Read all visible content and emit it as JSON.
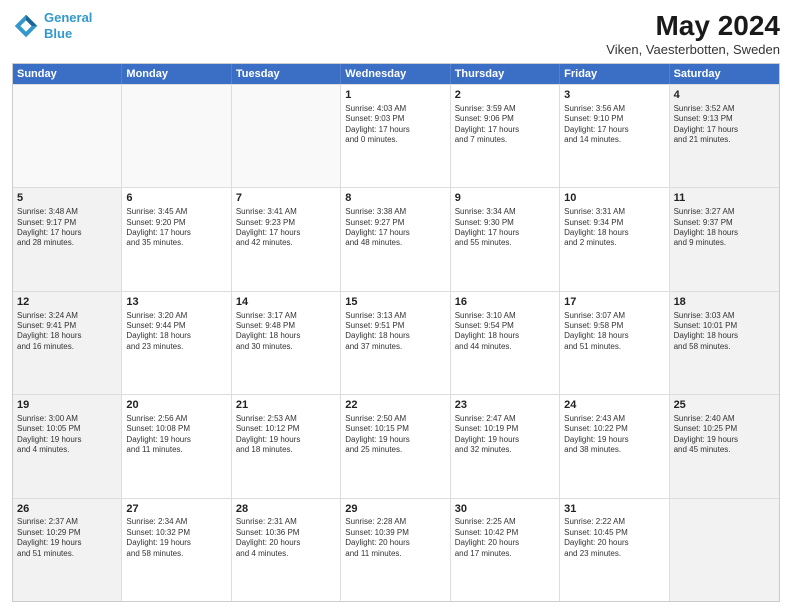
{
  "logo": {
    "line1": "General",
    "line2": "Blue"
  },
  "title": "May 2024",
  "subtitle": "Viken, Vaesterbotten, Sweden",
  "days": [
    "Sunday",
    "Monday",
    "Tuesday",
    "Wednesday",
    "Thursday",
    "Friday",
    "Saturday"
  ],
  "rows": [
    [
      {
        "day": "",
        "info": "",
        "empty": true
      },
      {
        "day": "",
        "info": "",
        "empty": true
      },
      {
        "day": "",
        "info": "",
        "empty": true
      },
      {
        "day": "1",
        "info": "Sunrise: 4:03 AM\nSunset: 9:03 PM\nDaylight: 17 hours\nand 0 minutes.",
        "empty": false
      },
      {
        "day": "2",
        "info": "Sunrise: 3:59 AM\nSunset: 9:06 PM\nDaylight: 17 hours\nand 7 minutes.",
        "empty": false
      },
      {
        "day": "3",
        "info": "Sunrise: 3:56 AM\nSunset: 9:10 PM\nDaylight: 17 hours\nand 14 minutes.",
        "empty": false
      },
      {
        "day": "4",
        "info": "Sunrise: 3:52 AM\nSunset: 9:13 PM\nDaylight: 17 hours\nand 21 minutes.",
        "empty": false,
        "shaded": true
      }
    ],
    [
      {
        "day": "5",
        "info": "Sunrise: 3:48 AM\nSunset: 9:17 PM\nDaylight: 17 hours\nand 28 minutes.",
        "empty": false,
        "shaded": true
      },
      {
        "day": "6",
        "info": "Sunrise: 3:45 AM\nSunset: 9:20 PM\nDaylight: 17 hours\nand 35 minutes.",
        "empty": false
      },
      {
        "day": "7",
        "info": "Sunrise: 3:41 AM\nSunset: 9:23 PM\nDaylight: 17 hours\nand 42 minutes.",
        "empty": false
      },
      {
        "day": "8",
        "info": "Sunrise: 3:38 AM\nSunset: 9:27 PM\nDaylight: 17 hours\nand 48 minutes.",
        "empty": false
      },
      {
        "day": "9",
        "info": "Sunrise: 3:34 AM\nSunset: 9:30 PM\nDaylight: 17 hours\nand 55 minutes.",
        "empty": false
      },
      {
        "day": "10",
        "info": "Sunrise: 3:31 AM\nSunset: 9:34 PM\nDaylight: 18 hours\nand 2 minutes.",
        "empty": false
      },
      {
        "day": "11",
        "info": "Sunrise: 3:27 AM\nSunset: 9:37 PM\nDaylight: 18 hours\nand 9 minutes.",
        "empty": false,
        "shaded": true
      }
    ],
    [
      {
        "day": "12",
        "info": "Sunrise: 3:24 AM\nSunset: 9:41 PM\nDaylight: 18 hours\nand 16 minutes.",
        "empty": false,
        "shaded": true
      },
      {
        "day": "13",
        "info": "Sunrise: 3:20 AM\nSunset: 9:44 PM\nDaylight: 18 hours\nand 23 minutes.",
        "empty": false
      },
      {
        "day": "14",
        "info": "Sunrise: 3:17 AM\nSunset: 9:48 PM\nDaylight: 18 hours\nand 30 minutes.",
        "empty": false
      },
      {
        "day": "15",
        "info": "Sunrise: 3:13 AM\nSunset: 9:51 PM\nDaylight: 18 hours\nand 37 minutes.",
        "empty": false
      },
      {
        "day": "16",
        "info": "Sunrise: 3:10 AM\nSunset: 9:54 PM\nDaylight: 18 hours\nand 44 minutes.",
        "empty": false
      },
      {
        "day": "17",
        "info": "Sunrise: 3:07 AM\nSunset: 9:58 PM\nDaylight: 18 hours\nand 51 minutes.",
        "empty": false
      },
      {
        "day": "18",
        "info": "Sunrise: 3:03 AM\nSunset: 10:01 PM\nDaylight: 18 hours\nand 58 minutes.",
        "empty": false,
        "shaded": true
      }
    ],
    [
      {
        "day": "19",
        "info": "Sunrise: 3:00 AM\nSunset: 10:05 PM\nDaylight: 19 hours\nand 4 minutes.",
        "empty": false,
        "shaded": true
      },
      {
        "day": "20",
        "info": "Sunrise: 2:56 AM\nSunset: 10:08 PM\nDaylight: 19 hours\nand 11 minutes.",
        "empty": false
      },
      {
        "day": "21",
        "info": "Sunrise: 2:53 AM\nSunset: 10:12 PM\nDaylight: 19 hours\nand 18 minutes.",
        "empty": false
      },
      {
        "day": "22",
        "info": "Sunrise: 2:50 AM\nSunset: 10:15 PM\nDaylight: 19 hours\nand 25 minutes.",
        "empty": false
      },
      {
        "day": "23",
        "info": "Sunrise: 2:47 AM\nSunset: 10:19 PM\nDaylight: 19 hours\nand 32 minutes.",
        "empty": false
      },
      {
        "day": "24",
        "info": "Sunrise: 2:43 AM\nSunset: 10:22 PM\nDaylight: 19 hours\nand 38 minutes.",
        "empty": false
      },
      {
        "day": "25",
        "info": "Sunrise: 2:40 AM\nSunset: 10:25 PM\nDaylight: 19 hours\nand 45 minutes.",
        "empty": false,
        "shaded": true
      }
    ],
    [
      {
        "day": "26",
        "info": "Sunrise: 2:37 AM\nSunset: 10:29 PM\nDaylight: 19 hours\nand 51 minutes.",
        "empty": false,
        "shaded": true
      },
      {
        "day": "27",
        "info": "Sunrise: 2:34 AM\nSunset: 10:32 PM\nDaylight: 19 hours\nand 58 minutes.",
        "empty": false
      },
      {
        "day": "28",
        "info": "Sunrise: 2:31 AM\nSunset: 10:36 PM\nDaylight: 20 hours\nand 4 minutes.",
        "empty": false
      },
      {
        "day": "29",
        "info": "Sunrise: 2:28 AM\nSunset: 10:39 PM\nDaylight: 20 hours\nand 11 minutes.",
        "empty": false
      },
      {
        "day": "30",
        "info": "Sunrise: 2:25 AM\nSunset: 10:42 PM\nDaylight: 20 hours\nand 17 minutes.",
        "empty": false
      },
      {
        "day": "31",
        "info": "Sunrise: 2:22 AM\nSunset: 10:45 PM\nDaylight: 20 hours\nand 23 minutes.",
        "empty": false
      },
      {
        "day": "",
        "info": "",
        "empty": true,
        "shaded": true
      }
    ]
  ]
}
